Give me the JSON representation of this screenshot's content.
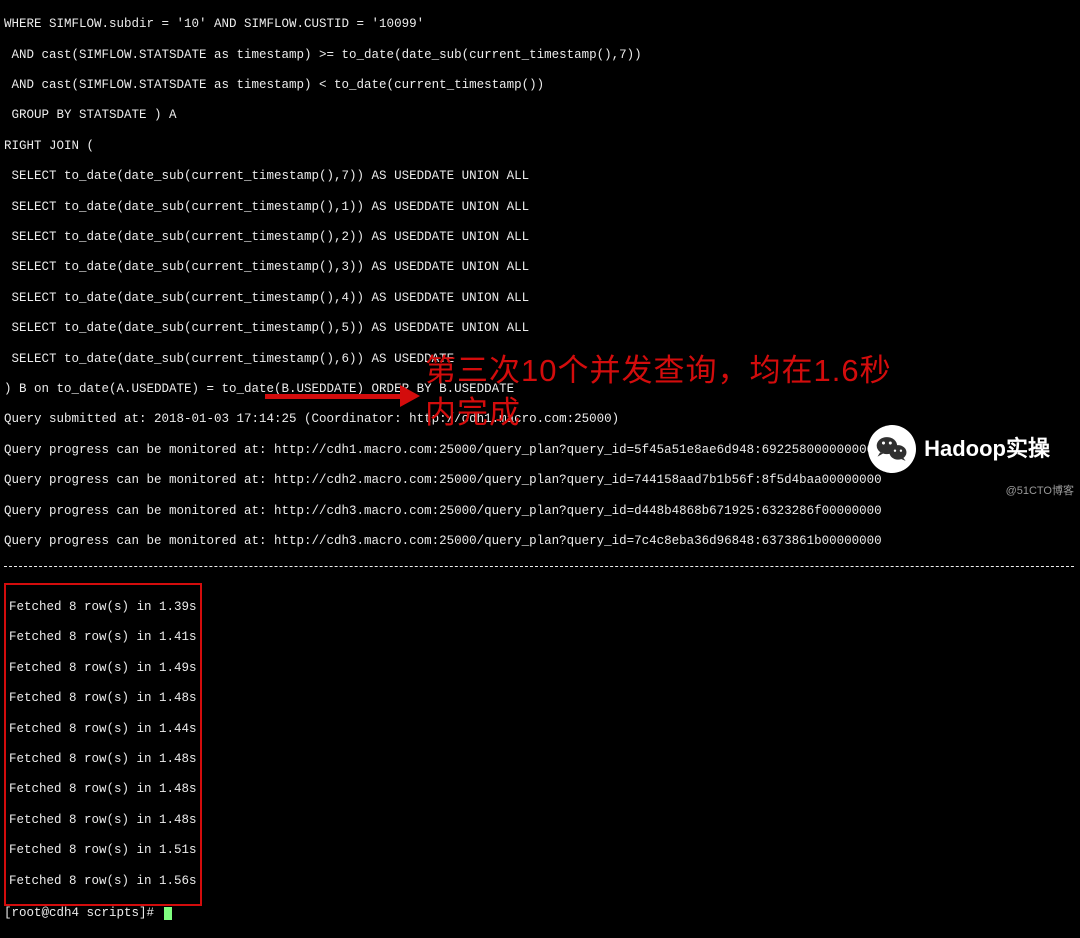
{
  "sql": [
    "WHERE SIMFLOW.subdir = '10' AND SIMFLOW.CUSTID = '10099'",
    " AND cast(SIMFLOW.STATSDATE as timestamp) >= to_date(date_sub(current_timestamp(),7))",
    " AND cast(SIMFLOW.STATSDATE as timestamp) < to_date(current_timestamp())",
    " GROUP BY STATSDATE ) A",
    "RIGHT JOIN (",
    " SELECT to_date(date_sub(current_timestamp(),7)) AS USEDDATE UNION ALL",
    " SELECT to_date(date_sub(current_timestamp(),1)) AS USEDDATE UNION ALL",
    " SELECT to_date(date_sub(current_timestamp(),2)) AS USEDDATE UNION ALL",
    " SELECT to_date(date_sub(current_timestamp(),3)) AS USEDDATE UNION ALL",
    " SELECT to_date(date_sub(current_timestamp(),4)) AS USEDDATE UNION ALL",
    " SELECT to_date(date_sub(current_timestamp(),5)) AS USEDDATE UNION ALL",
    " SELECT to_date(date_sub(current_timestamp(),6)) AS USEDDATE",
    ") B on to_date(A.USEDDATE) = to_date(B.USEDDATE) ORDER BY B.USEDDATE"
  ],
  "submit": "Query submitted at: 2018-01-03 17:14:25 (Coordinator: http://cdh1.macro.com:25000)",
  "progress": [
    "Query progress can be monitored at: http://cdh1.macro.com:25000/query_plan?query_id=5f45a51e8ae6d948:692258000000000",
    "Query progress can be monitored at: http://cdh2.macro.com:25000/query_plan?query_id=744158aad7b1b56f:8f5d4baa00000000",
    "Query progress can be monitored at: http://cdh3.macro.com:25000/query_plan?query_id=d448b4868b671925:6323286f00000000",
    "Query progress can be monitored at: http://cdh3.macro.com:25000/query_plan?query_id=7c4c8eba36d96848:6373861b00000000"
  ],
  "fetched": [
    "Fetched 8 row(s) in 1.39s",
    "Fetched 8 row(s) in 1.41s",
    "Fetched 8 row(s) in 1.49s",
    "Fetched 8 row(s) in 1.48s",
    "Fetched 8 row(s) in 1.44s",
    "Fetched 8 row(s) in 1.48s",
    "Fetched 8 row(s) in 1.48s",
    "Fetched 8 row(s) in 1.48s",
    "Fetched 8 row(s) in 1.51s",
    "Fetched 8 row(s) in 1.56s"
  ],
  "prompt": "[root@cdh4 scripts]# ",
  "annotation": {
    "l1": "第三次10个并发查询，均在1.6秒",
    "l2": "内完成"
  },
  "badge": "Hadoop实操",
  "watermark": "@51CTO博客"
}
